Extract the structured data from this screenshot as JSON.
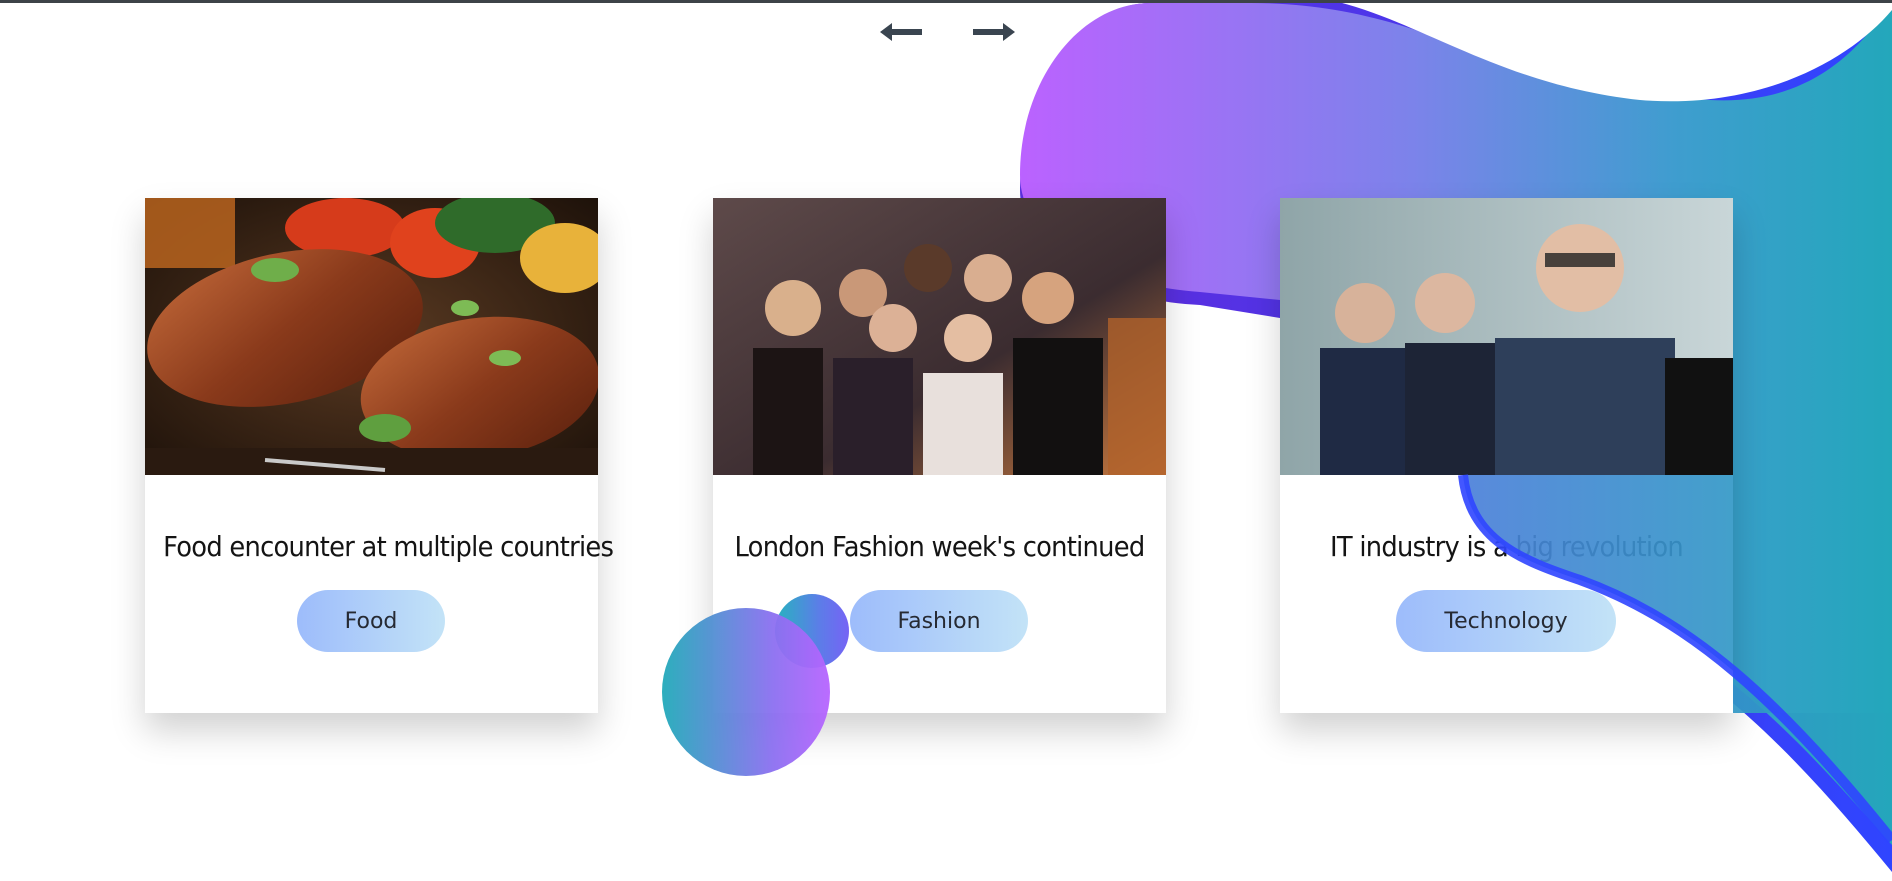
{
  "nav": {
    "prev_icon": "arrow-left-icon",
    "next_icon": "arrow-right-icon"
  },
  "colors": {
    "blob_start": "#b964ff",
    "blob_end": "#26a6bd",
    "tag_start": "#9dbcfb",
    "tag_end": "#c3e3f7",
    "arrow": "#3a4550"
  },
  "cards": [
    {
      "title": "Food encounter at multiple countries",
      "tag": "Food",
      "image": "grilled-steak-photo"
    },
    {
      "title": "London Fashion week's continued",
      "tag": "Fashion",
      "image": "party-crowd-photo"
    },
    {
      "title": "IT industry is a big revolution",
      "tag": "Technology",
      "image": "business-people-photo"
    }
  ]
}
